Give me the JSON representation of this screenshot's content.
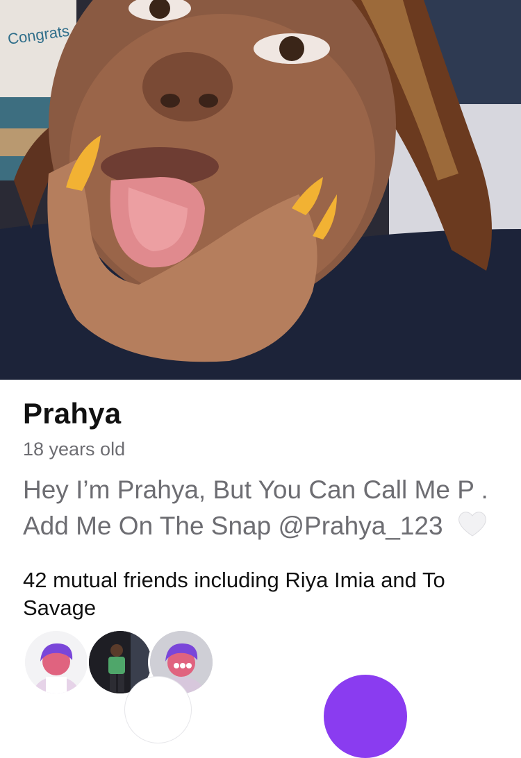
{
  "profile": {
    "name": "Prahya",
    "age": "18 years old",
    "bio": "Hey I’m Prahya, But You Can Call Me P . Add Me On The Snap @Prahya_123",
    "bio_emoji": "heart-icon"
  },
  "mutual": {
    "text": "42 mutual friends including Riya Imia and To Savage"
  },
  "photo": {
    "sign_text": "Congrats GRAD!"
  },
  "colors": {
    "accent": "#8a3cf0",
    "avatar_purple": "#7a46d9",
    "avatar_pink": "#e0637f",
    "nails": "#f2b233"
  }
}
